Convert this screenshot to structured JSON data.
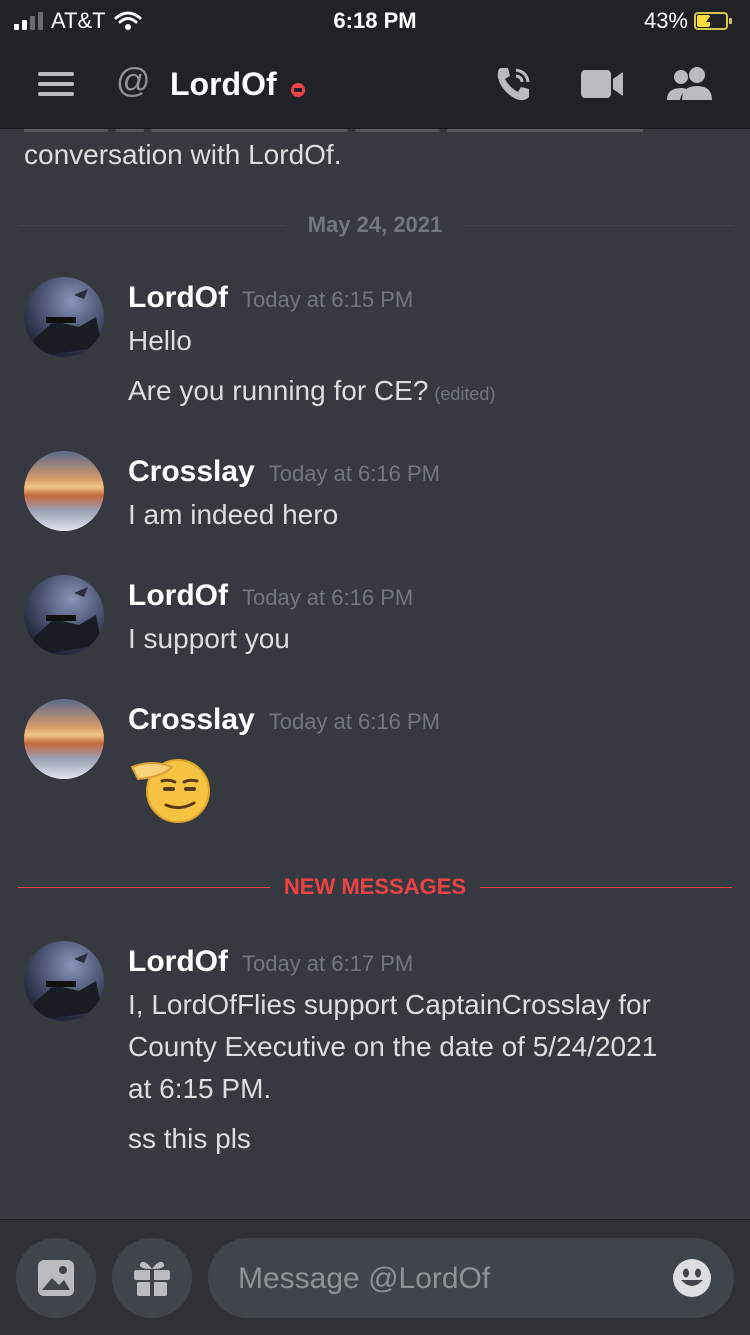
{
  "status_bar": {
    "carrier": "AT&T",
    "time": "6:18 PM",
    "battery": "43%"
  },
  "header": {
    "title": "LordOf",
    "status": "do-not-disturb"
  },
  "intro": {
    "text": "conversation with LordOf."
  },
  "dividers": {
    "date": "May 24, 2021",
    "new_messages": "NEW MESSAGES"
  },
  "colors": {
    "background": "#36393f",
    "header": "#202225",
    "new_messages": "#ed4245"
  },
  "messages": [
    {
      "author": "LordOf",
      "timestamp": "Today at 6:15 PM",
      "lines": [
        "Hello",
        "Are you running for CE?"
      ],
      "edited_label": "(edited)"
    },
    {
      "author": "Crosslay",
      "timestamp": "Today at 6:16 PM",
      "lines": [
        "I am indeed hero"
      ]
    },
    {
      "author": "LordOf",
      "timestamp": "Today at 6:16 PM",
      "lines": [
        "I support you"
      ]
    },
    {
      "author": "Crosslay",
      "timestamp": "Today at 6:16 PM",
      "emoji": "saluting-face"
    },
    {
      "author": "LordOf",
      "timestamp": "Today at 6:17 PM",
      "lines": [
        "I, LordOfFlies support CaptainCrosslay for",
        "County Executive on the date of 5/24/2021",
        "at 6:15 PM.",
        "ss this pls"
      ]
    }
  ],
  "composer": {
    "placeholder": "Message @LordOf"
  }
}
